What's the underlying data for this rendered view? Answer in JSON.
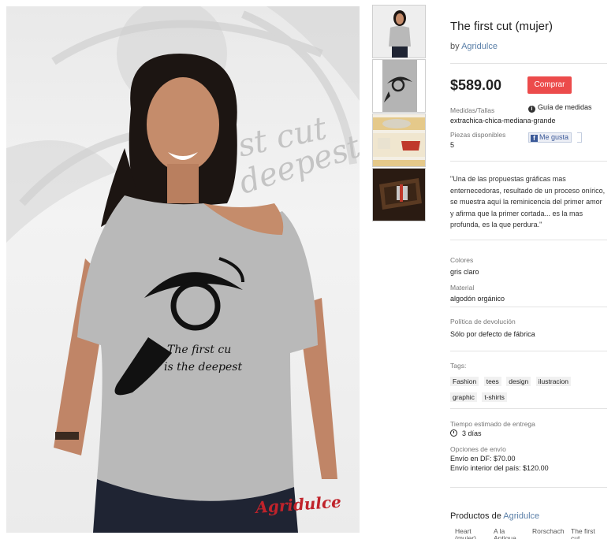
{
  "product": {
    "title": "The first cut (mujer)",
    "by_prefix": "by",
    "seller": "Agridulce",
    "price": "$589.00",
    "buy_label": "Comprar",
    "sizes_label": "Medidas/Tallas",
    "sizes_value": "extrachica-chica-mediana-grande",
    "size_guide_label": "Guía de medidas",
    "pieces_label": "Piezas disponibles",
    "pieces_value": "5",
    "like_label": "Me gusta",
    "description": "\"Una de las propuestas gráficas mas enternecedoras, resultado de un proceso onírico, se muestra aquí la reminicencia del primer amor y afirma que la primer cortada... es la mas profunda, es la que perdura.\"",
    "colors_label": "Colores",
    "colors_value": "gris claro",
    "material_label": "Material",
    "material_value": "algodón orgánico",
    "return_label": "Política de devolución",
    "return_value": "Sólo por defecto de fábrica",
    "tags_label": "Tags:",
    "tags": [
      "Fashion",
      "tees",
      "design",
      "ilustracion",
      "graphic",
      "t-shirts"
    ],
    "delivery_label": "Tiempo estimado de entrega",
    "delivery_value": "3 días",
    "shipping_label": "Opciones de envío",
    "shipping_df": "Envío en DF: $70.00",
    "shipping_interior": "Envío interior del país: $120.00",
    "related_prefix": "Productos de",
    "related_seller": "Agridulce",
    "related_items": [
      "Heart (mujer)",
      "A la Antigua",
      "Rorschach",
      "The first cut"
    ]
  },
  "image": {
    "print_text_1": "The first cu",
    "print_text_2": "is the deepest",
    "bg_text_1": "st cut",
    "bg_text_2": "deepest",
    "logo_text": "Agridulce"
  },
  "icons": {
    "info": "info-icon",
    "clock": "clock-icon",
    "facebook": "facebook-icon"
  },
  "colors": {
    "buy_button": "#ec4b4b",
    "link": "#5a7fa8",
    "facebook": "#3b5998"
  }
}
